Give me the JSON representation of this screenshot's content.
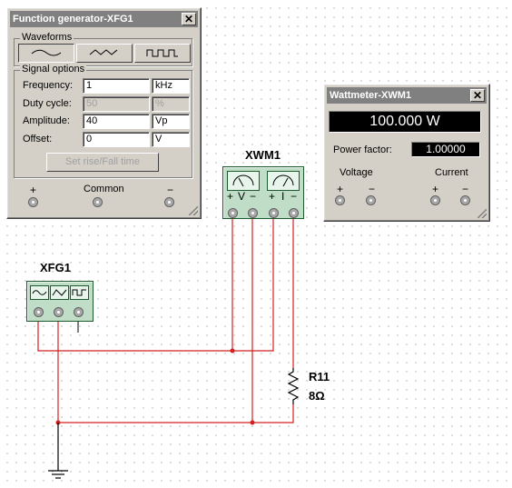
{
  "function_generator": {
    "title": "Function generator-XFG1",
    "close": "✕",
    "waveforms_label": "Waveforms",
    "signal_options_label": "Signal options",
    "fields": [
      {
        "label": "Frequency:",
        "value": "1",
        "unit": "kHz",
        "enabled": true
      },
      {
        "label": "Duty cycle:",
        "value": "50",
        "unit": "%",
        "enabled": false
      },
      {
        "label": "Amplitude:",
        "value": "40",
        "unit": "Vp",
        "enabled": true
      },
      {
        "label": "Offset:",
        "value": "0",
        "unit": "V",
        "enabled": true
      }
    ],
    "set_rise_fall_button": "Set rise/Fall time",
    "terminals": {
      "plus": "+",
      "common": "Common",
      "minus": "−"
    },
    "selected_waveform": "sine"
  },
  "wattmeter": {
    "title": "Wattmeter-XWM1",
    "close": "✕",
    "reading": "100.000 W",
    "power_factor_label": "Power factor:",
    "power_factor_value": "1.00000",
    "voltage_label": "Voltage",
    "current_label": "Current",
    "plus": "+",
    "minus": "−"
  },
  "schematic": {
    "wattmeter_ref": "XWM1",
    "wattmeter_pins": {
      "v_plus": "+",
      "v": "V",
      "v_minus": "−",
      "i_plus": "+",
      "i": "I",
      "i_minus": "−"
    },
    "generator_ref": "XFG1",
    "resistor_ref": "R11",
    "resistor_value": "8Ω",
    "wire_color": "#d42020"
  }
}
